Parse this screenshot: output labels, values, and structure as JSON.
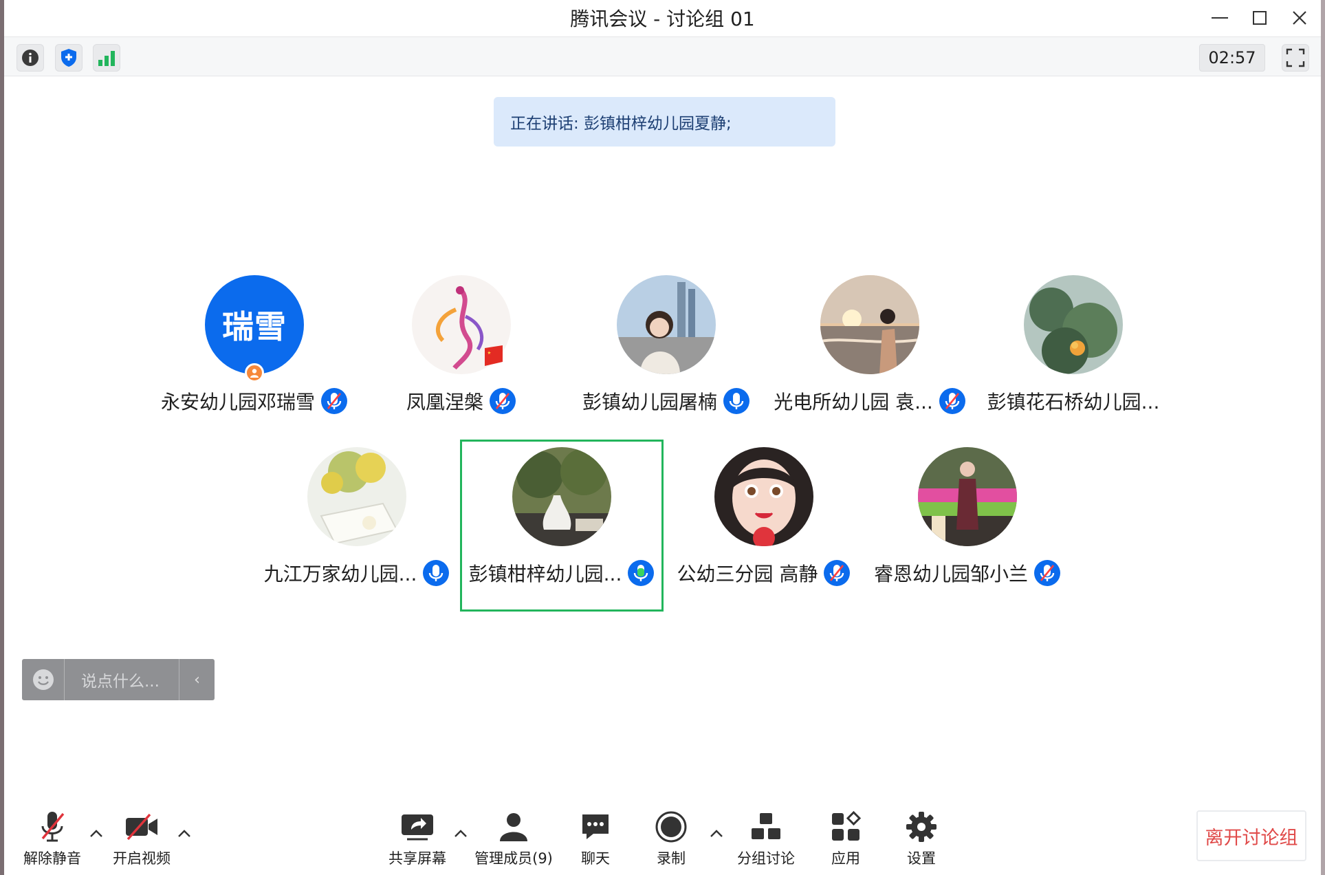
{
  "window": {
    "title": "腾讯会议 - 讨论组 01"
  },
  "toolbar": {
    "info_icon": "info-icon",
    "security_icon": "shield-plus-icon",
    "network_icon": "signal-bars-icon",
    "timer": "02:57",
    "fullscreen_icon": "fullscreen-icon"
  },
  "speaking": {
    "text": "正在讲话: 彭镇柑梓幼儿园夏静;"
  },
  "participants": [
    {
      "name": "永安幼儿园邓瑞雪",
      "avatar_text": "瑞雪",
      "mic": "muted",
      "host": true
    },
    {
      "name": "凤凰涅槃",
      "avatar_text": "",
      "mic": "muted"
    },
    {
      "name": "彭镇幼儿园屠楠",
      "avatar_text": "",
      "mic": "on"
    },
    {
      "name": "光电所幼儿园 袁...",
      "avatar_text": "",
      "mic": "muted"
    },
    {
      "name": "彭镇花石桥幼儿园...",
      "avatar_text": "",
      "mic": "none"
    },
    {
      "name": "九江万家幼儿园...",
      "avatar_text": "",
      "mic": "on"
    },
    {
      "name": "彭镇柑梓幼儿园...",
      "avatar_text": "",
      "mic": "speaking",
      "active": true
    },
    {
      "name": "公幼三分园 高静",
      "avatar_text": "",
      "mic": "muted"
    },
    {
      "name": "睿恩幼儿园邹小兰",
      "avatar_text": "",
      "mic": "muted"
    }
  ],
  "chat": {
    "placeholder": "说点什么...",
    "arrow": "‹"
  },
  "bottom": {
    "unmute": "解除静音",
    "video": "开启视频",
    "share": "共享屏幕",
    "members": "管理成员(9)",
    "chat": "聊天",
    "record": "录制",
    "breakout": "分组讨论",
    "apps": "应用",
    "settings": "设置",
    "leave": "离开讨论组"
  },
  "colors": {
    "accent": "#0b6bed",
    "active_border": "#22b55c",
    "leave_text": "#e04a49",
    "speaking_bg": "#dbe9fb"
  }
}
